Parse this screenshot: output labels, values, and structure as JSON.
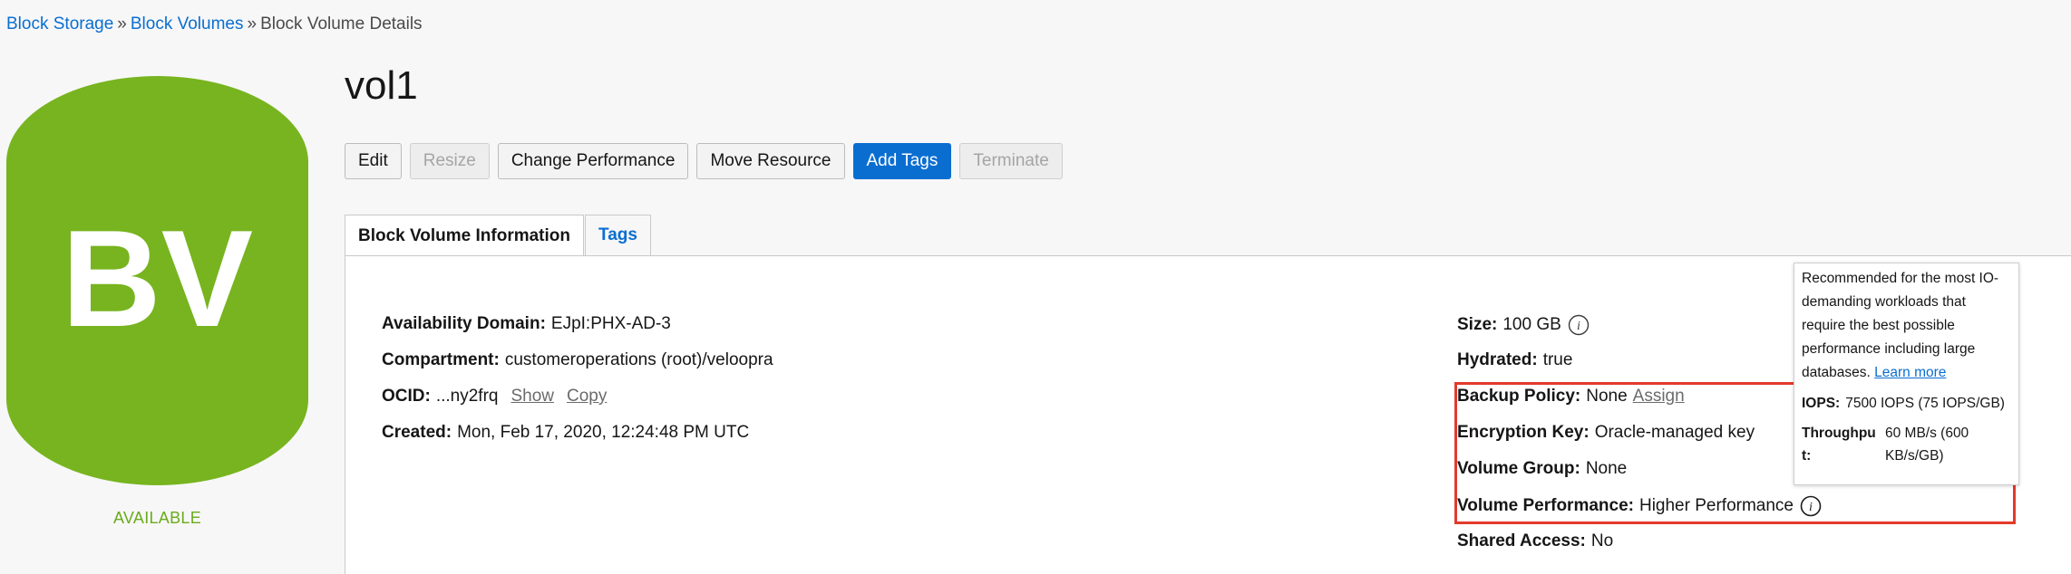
{
  "breadcrumb": {
    "items": [
      {
        "label": "Block Storage",
        "link": true
      },
      {
        "label": "Block Volumes",
        "link": true
      },
      {
        "label": "Block Volume Details",
        "link": false
      }
    ],
    "separator": "»"
  },
  "resource_icon": {
    "initials": "BV",
    "color": "#77b41f",
    "status": "AVAILABLE",
    "status_color": "#6aab1c"
  },
  "title": "vol1",
  "actions": {
    "edit": "Edit",
    "resize": "Resize",
    "change_performance": "Change Performance",
    "move_resource": "Move Resource",
    "add_tags": "Add Tags",
    "terminate": "Terminate"
  },
  "tabs": {
    "info": "Block Volume Information",
    "tags": "Tags"
  },
  "details_left": {
    "availability_domain": {
      "label": "Availability Domain:",
      "value": "EJpI:PHX-AD-3"
    },
    "compartment": {
      "label": "Compartment:",
      "value": "customeroperations (root)/veloopra"
    },
    "ocid": {
      "label": "OCID:",
      "value": "...ny2frq",
      "show": "Show",
      "copy": "Copy"
    },
    "created": {
      "label": "Created:",
      "value": "Mon, Feb 17, 2020, 12:24:48 PM UTC"
    }
  },
  "details_right": {
    "size": {
      "label": "Size:",
      "value": "100 GB"
    },
    "hydrated": {
      "label": "Hydrated:",
      "value": "true"
    },
    "backup_policy": {
      "label": "Backup Policy:",
      "value": "None",
      "action": "Assign"
    },
    "encryption_key": {
      "label": "Encryption Key:",
      "value": "Oracle-managed key"
    },
    "volume_group": {
      "label": "Volume Group:",
      "value": "None"
    },
    "volume_performance": {
      "label": "Volume Performance:",
      "value": "Higher Performance"
    },
    "shared_access": {
      "label": "Shared Access:",
      "value": "No"
    }
  },
  "tooltip": {
    "description": "Recommended for the most IO-demanding workloads that require the best possible performance including large databases.",
    "learn_more": "Learn more",
    "iops_label": "IOPS:",
    "iops_value": "7500 IOPS (75 IOPS/GB)",
    "throughput_label": "Throughput:",
    "throughput_value": "60 MB/s (600 KB/s/GB)"
  },
  "colors": {
    "link": "#0a6ed1",
    "primary_button": "#0a6ed1",
    "highlight": "#e23a2c"
  }
}
